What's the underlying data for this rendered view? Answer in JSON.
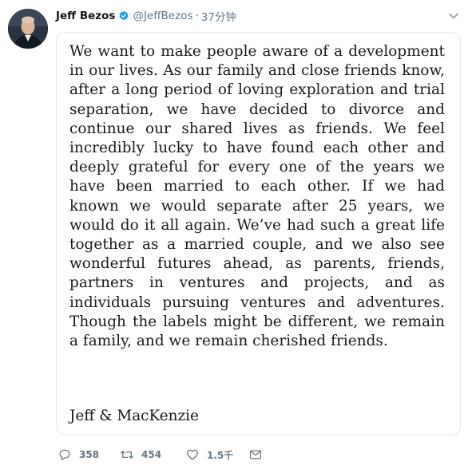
{
  "tweet": {
    "author_name": "Jeff Bezos",
    "handle": "@JeffBezos",
    "separator": "·",
    "time": "37分钟",
    "statement": "We want to make people aware of a development in our lives. As our family and close friends know, after a long period of loving exploration and trial separation, we have decided to divorce and continue our shared lives as friends.  We feel incredibly lucky to have found each other and deeply grateful for every one of the years we have been married to each other.  If we had known we would separate after 25 years, we would do it all again.  We’ve had such a great life together as a married couple, and we also see wonderful futures ahead, as parents, friends, partners in ventures and projects, and as individuals pursuing ventures and adventures.  Though the labels might be different, we remain a family, and we remain cherished friends.",
    "signature": "Jeff & MacKenzie"
  },
  "actions": {
    "reply_count": "358",
    "retweet_count": "454",
    "like_count": "1.5千"
  },
  "icons": {
    "verified": "verified-badge-icon",
    "caret": "chevron-down-icon",
    "reply": "reply-bubble-icon",
    "retweet": "retweet-icon",
    "like": "heart-icon",
    "dm": "envelope-icon"
  },
  "colors": {
    "verified_blue": "#1da1f2",
    "muted_gray": "#657786",
    "border": "#e1e8ed"
  }
}
